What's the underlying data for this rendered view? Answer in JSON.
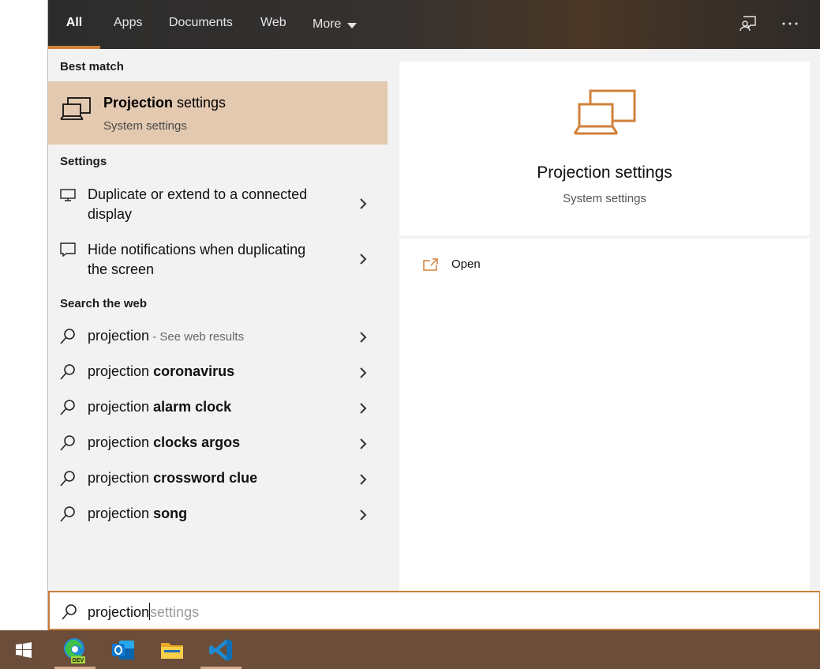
{
  "nav": {
    "tabs": [
      {
        "label": "All",
        "active": true
      },
      {
        "label": "Apps"
      },
      {
        "label": "Documents"
      },
      {
        "label": "Web"
      },
      {
        "label": "More"
      }
    ],
    "icons": [
      "feedback-icon",
      "more-options-icon"
    ]
  },
  "best_match": {
    "header": "Best match",
    "title_bold": "Projection",
    "title_rest": " settings",
    "subtitle": "System settings"
  },
  "settings": {
    "header": "Settings",
    "items": [
      {
        "line1": "Duplicate or extend to a connected",
        "line2": "display",
        "icon": "monitor-icon"
      },
      {
        "line1": "Hide notifications when duplicating",
        "line2": "the screen",
        "icon": "notification-icon"
      }
    ]
  },
  "web": {
    "header": "Search the web",
    "items": [
      {
        "prefix": "projection",
        "bold": "",
        "hint": " - See web results"
      },
      {
        "prefix": "projection ",
        "bold": "coronavirus",
        "hint": ""
      },
      {
        "prefix": "projection ",
        "bold": "alarm clock",
        "hint": ""
      },
      {
        "prefix": "projection ",
        "bold": "clocks argos",
        "hint": ""
      },
      {
        "prefix": "projection ",
        "bold": "crossword clue",
        "hint": ""
      },
      {
        "prefix": "projection ",
        "bold": "song",
        "hint": ""
      }
    ]
  },
  "preview": {
    "title": "Projection settings",
    "subtitle": "System settings",
    "action_open": "Open"
  },
  "search": {
    "typed": "projection",
    "suggestion": "settings"
  },
  "taskbar": {
    "items": [
      "windows-start",
      "edge-dev",
      "outlook",
      "file-explorer",
      "vscode"
    ],
    "edge_badge": "DEV"
  },
  "colors": {
    "accent": "#d2813a",
    "best_match_bg": "#e3c9b0",
    "taskbar_bg": "#6b4d3a"
  }
}
